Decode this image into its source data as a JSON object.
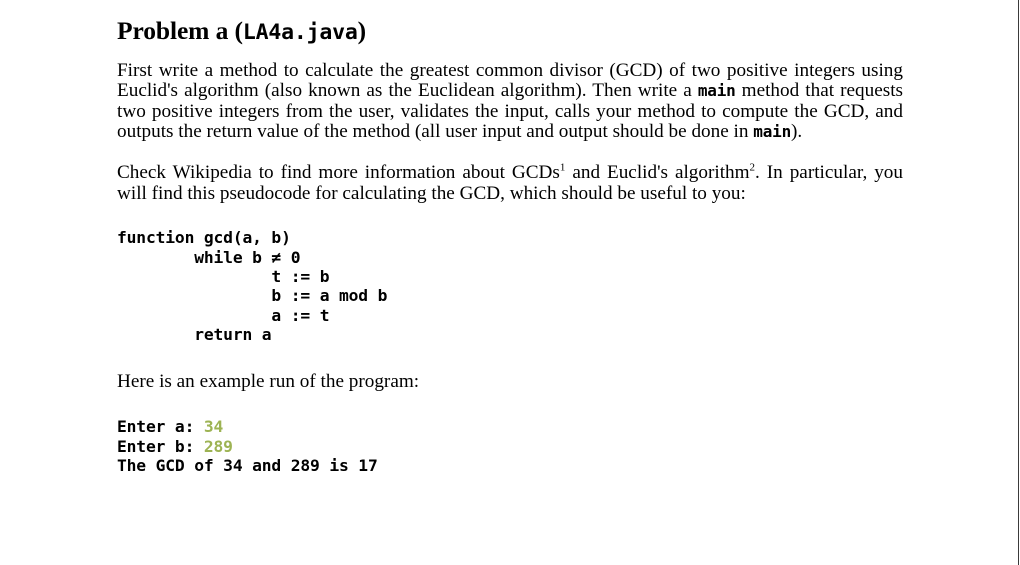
{
  "document": {
    "title": {
      "prefix": "Problem a (",
      "filename": "LA4a.java",
      "suffix": ")"
    },
    "paragraphs": {
      "intro": {
        "part1": "First write a method to calculate the greatest common divisor (GCD) of two positive integers using Euclid's algorithm (also known as the Euclidean algorithm). Then write a ",
        "mono1": "main",
        "part2": " method that requests two positive integers from the user, validates the input, calls your method to compute the GCD, and outputs the return value of the method (all user input and output should be done in ",
        "mono2": "main",
        "part3": ")."
      },
      "wikipedia": {
        "part1": "Check Wikipedia to find more information about GCDs",
        "footnote1": "1",
        "part2": " and Euclid's algorithm",
        "footnote2": "2",
        "part3": ". In particular, you will find this pseudocode for calculating the GCD, which should be useful to you:"
      },
      "example_run_label": "Here is an example run of the program:"
    },
    "pseudocode": {
      "lines": [
        "function gcd(a, b)",
        "        while b ≠ 0",
        "                t := b",
        "                b := a mod b",
        "                a := t",
        "        return a"
      ]
    },
    "console": {
      "prompt_a": "Enter a: ",
      "value_a": "34",
      "prompt_b": "Enter b: ",
      "value_b": "289",
      "result_line": "The GCD of 34 and 289 is 17"
    },
    "colors": {
      "text": "#000000",
      "input_value": "#9db353",
      "background": "#ffffff",
      "page_edge": "#3a3a3a"
    }
  }
}
